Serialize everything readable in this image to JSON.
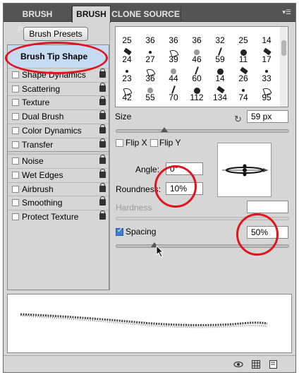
{
  "tabs": [
    {
      "label": "BRUSH PRESETS",
      "active": false
    },
    {
      "label": "BRUSH",
      "active": true
    },
    {
      "label": "CLONE SOURCE",
      "active": false
    }
  ],
  "panel_menu_icon": "panel-menu-icon",
  "brush_presets_button": "Brush Presets",
  "brush_tip_shape": "Brush Tip Shape",
  "options": [
    {
      "label": "Shape Dynamics",
      "checked": false,
      "lock": true
    },
    {
      "label": "Scattering",
      "checked": false,
      "lock": true
    },
    {
      "label": "Texture",
      "checked": false,
      "lock": true
    },
    {
      "label": "Dual Brush",
      "checked": false,
      "lock": true
    },
    {
      "label": "Color Dynamics",
      "checked": false,
      "lock": true
    },
    {
      "label": "Transfer",
      "checked": false,
      "lock": true
    },
    {
      "label": "Noise",
      "checked": false,
      "lock": true
    },
    {
      "label": "Wet Edges",
      "checked": false,
      "lock": true
    },
    {
      "label": "Airbrush",
      "checked": false,
      "lock": true
    },
    {
      "label": "Smoothing",
      "checked": false,
      "lock": true
    },
    {
      "label": "Protect Texture",
      "checked": false,
      "lock": true
    }
  ],
  "tip_sizes": [
    "25",
    "36",
    "36",
    "36",
    "32",
    "25",
    "14",
    "24",
    "27",
    "39",
    "46",
    "59",
    "11",
    "17",
    "23",
    "36",
    "44",
    "60",
    "14",
    "26",
    "33",
    "42",
    "55",
    "70",
    "112",
    "134",
    "74",
    "95"
  ],
  "size": {
    "label": "Size",
    "value": "59 px"
  },
  "flip_x": {
    "label": "Flip X",
    "checked": false
  },
  "flip_y": {
    "label": "Flip Y",
    "checked": false
  },
  "angle": {
    "label": "Angle:",
    "value": "0°"
  },
  "roundness": {
    "label": "Roundness:",
    "value": "10%"
  },
  "hardness": {
    "label": "Hardness",
    "value": ""
  },
  "spacing": {
    "label": "Spacing",
    "checked": true,
    "value": "50%"
  },
  "highlight_color": "#e0141e",
  "footer_icons": [
    "eye-icon",
    "grid-icon",
    "new-preset-icon"
  ]
}
